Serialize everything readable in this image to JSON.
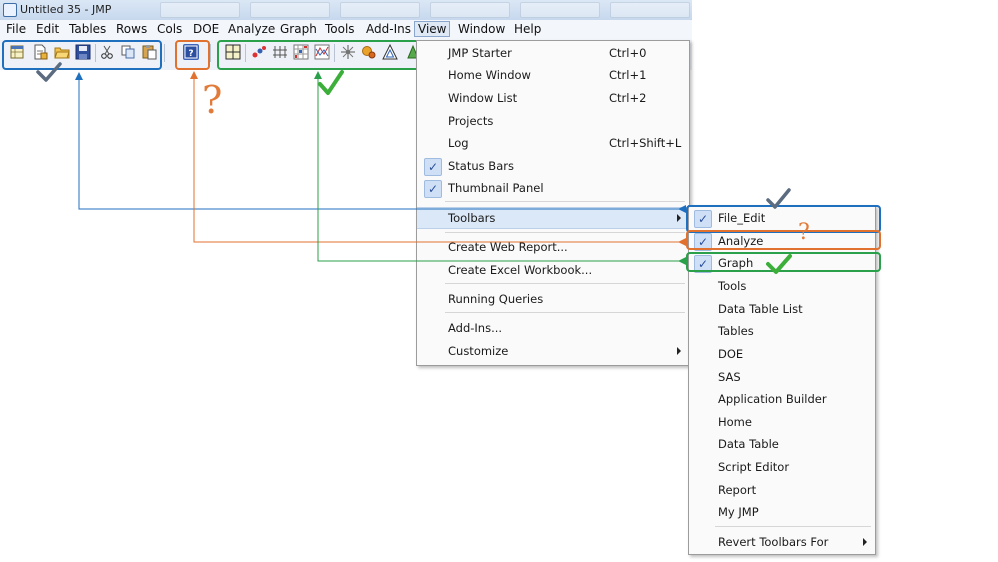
{
  "window": {
    "title": "Untitled 35 - JMP"
  },
  "menubar": {
    "items": [
      "File",
      "Edit",
      "Tables",
      "Rows",
      "Cols",
      "DOE",
      "Analyze",
      "Graph",
      "Tools",
      "Add-Ins",
      "View",
      "Window",
      "Help"
    ],
    "active": "View"
  },
  "view_menu": {
    "items": [
      {
        "label": "JMP Starter",
        "shortcut": "Ctrl+0"
      },
      {
        "label": "Home Window",
        "shortcut": "Ctrl+1"
      },
      {
        "label": "Window List",
        "shortcut": "Ctrl+2"
      },
      {
        "label": "Projects",
        "shortcut": ""
      },
      {
        "label": "Log",
        "shortcut": "Ctrl+Shift+L"
      },
      {
        "label": "Status Bars",
        "shortcut": "",
        "checked": true
      },
      {
        "label": "Thumbnail Panel",
        "shortcut": "",
        "checked": true
      },
      {
        "label": "Toolbars",
        "shortcut": "",
        "submenu": true,
        "highlighted": true
      },
      {
        "label": "Create Web Report...",
        "shortcut": ""
      },
      {
        "label": "Create Excel Workbook...",
        "shortcut": ""
      },
      {
        "label": "Running Queries",
        "shortcut": ""
      },
      {
        "label": "Add-Ins...",
        "shortcut": ""
      },
      {
        "label": "Customize",
        "shortcut": "",
        "submenu": true
      }
    ]
  },
  "toolbars_submenu": {
    "items": [
      {
        "label": "File_Edit",
        "checked": true
      },
      {
        "label": "Analyze",
        "checked": true
      },
      {
        "label": "Graph",
        "checked": true
      },
      {
        "label": "Tools",
        "checked": false
      },
      {
        "label": "Data Table List",
        "checked": false
      },
      {
        "label": "Tables",
        "checked": false
      },
      {
        "label": "DOE",
        "checked": false
      },
      {
        "label": "SAS",
        "checked": false
      },
      {
        "label": "Application Builder",
        "checked": false
      },
      {
        "label": "Home",
        "checked": false
      },
      {
        "label": "Data Table",
        "checked": false
      },
      {
        "label": "Script Editor",
        "checked": false
      },
      {
        "label": "Report",
        "checked": false
      },
      {
        "label": "My JMP",
        "checked": false
      },
      {
        "label": "Revert Toolbars For",
        "checked": false,
        "submenu": true
      }
    ]
  },
  "annotations": {
    "question_mark": "?",
    "colors": {
      "file_edit": "#1f6fbf",
      "analyze": "#e0712e",
      "graph": "#2aa04a",
      "gray_check": "#5b6b80",
      "green_check": "#3cae3a"
    }
  }
}
